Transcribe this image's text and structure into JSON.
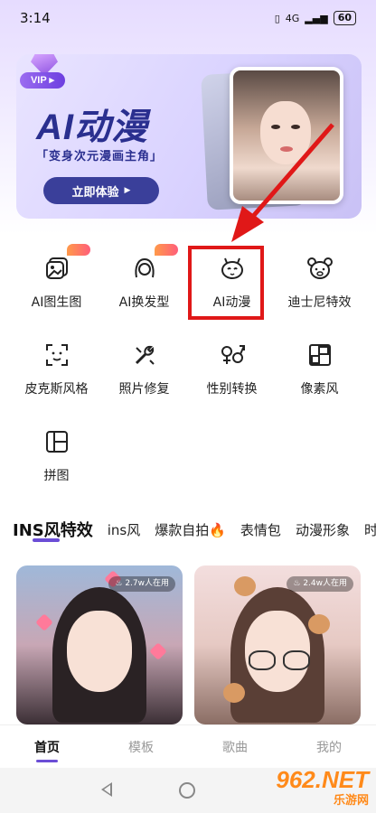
{
  "status_bar": {
    "time": "3:14",
    "signal": "4G",
    "battery": "60"
  },
  "banner": {
    "vip_label": "VIP",
    "title": "AI动漫",
    "subtitle": "「变身次元漫画主角」",
    "cta_label": "立即体验",
    "cta_arrow": "▶"
  },
  "features": [
    {
      "label": "AI图生图",
      "icon": "image-gen-icon",
      "hot": true
    },
    {
      "label": "AI换发型",
      "icon": "hairstyle-icon",
      "hot": true
    },
    {
      "label": "AI动漫",
      "icon": "anime-face-icon",
      "hot": false
    },
    {
      "label": "迪士尼特效",
      "icon": "bear-icon",
      "hot": false
    },
    {
      "label": "皮克斯风格",
      "icon": "face-scan-icon",
      "hot": false
    },
    {
      "label": "照片修复",
      "icon": "repair-tools-icon",
      "hot": false
    },
    {
      "label": "性别转换",
      "icon": "gender-icon",
      "hot": false
    },
    {
      "label": "像素风",
      "icon": "pixel-icon",
      "hot": false
    },
    {
      "label": "拼图",
      "icon": "collage-icon",
      "hot": false
    }
  ],
  "category_tabs": [
    "INS风特效",
    "ins风",
    "爆款自拍🔥",
    "表情包",
    "动漫形象",
    "时"
  ],
  "cards": [
    {
      "usage": "2.7w人在用"
    },
    {
      "usage": "2.4w人在用"
    }
  ],
  "bottom_nav": [
    "首页",
    "模板",
    "歌曲",
    "我的"
  ],
  "watermark": {
    "main": "962.NET",
    "sub": "乐游网"
  },
  "colors": {
    "accent": "#6b4ed6",
    "highlight": "#e01818",
    "banner_text": "#2a2f8f"
  }
}
